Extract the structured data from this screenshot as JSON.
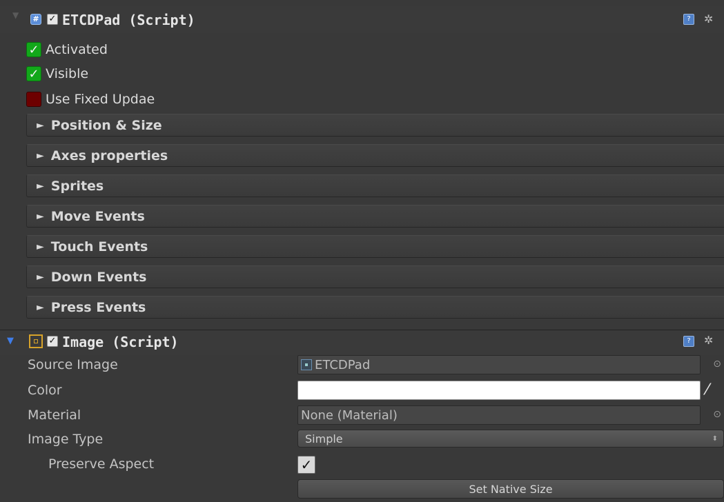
{
  "components": [
    {
      "title": "ETCDPad (Script)",
      "foldout_glyph": "▼",
      "icon": "script-icon",
      "icon_glyph": "#",
      "enabled_glyph": "✓",
      "help_glyph": "?",
      "settings_glyph": "✲",
      "toggles": [
        {
          "label": "Activated",
          "checked": true,
          "glyph": "✓"
        },
        {
          "label": "Visible",
          "checked": true,
          "glyph": "✓"
        },
        {
          "label": "Use Fixed Updae",
          "checked": false,
          "glyph": ""
        }
      ],
      "sections": [
        {
          "label": "Position & Size",
          "arrow": "►"
        },
        {
          "label": "Axes properties",
          "arrow": "►"
        },
        {
          "label": "Sprites",
          "arrow": "►"
        },
        {
          "label": "Move Events",
          "arrow": "►"
        },
        {
          "label": "Touch Events",
          "arrow": "►"
        },
        {
          "label": "Down Events",
          "arrow": "►"
        },
        {
          "label": "Press Events",
          "arrow": "►"
        }
      ]
    },
    {
      "title": "Image (Script)",
      "foldout_glyph": "▼",
      "icon": "image-icon",
      "enabled_glyph": "✓",
      "help_glyph": "?",
      "settings_glyph": "✲",
      "properties": {
        "source_image": {
          "label": "Source Image",
          "value": "ETCDPad",
          "picker_glyph": "⊙"
        },
        "color": {
          "label": "Color",
          "value_hex": "#FFFFFF",
          "dropper_glyph": "⁄"
        },
        "material": {
          "label": "Material",
          "value": "None (Material)",
          "picker_glyph": "⊙"
        },
        "image_type": {
          "label": "Image Type",
          "value": "Simple",
          "arrows_glyph": "⬍"
        },
        "preserve_aspect": {
          "label": "Preserve Aspect",
          "checked": true,
          "glyph": "✓"
        },
        "native_button": "Set Native Size"
      }
    }
  ],
  "colors": {
    "background": "#393939",
    "toggle_on": "#12A81A",
    "toggle_off": "#6D0000",
    "foldout_open": "#3F7DE8",
    "image_icon": "#D7A32A"
  }
}
